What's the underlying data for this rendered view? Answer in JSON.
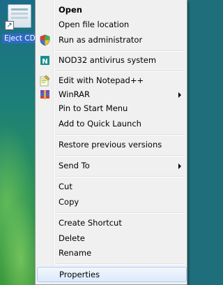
{
  "desktop": {
    "shortcut_label": "Eject CD",
    "shortcut_icon": "shortcut-arrow-icon"
  },
  "menu": {
    "groups": [
      [
        {
          "label": "Open",
          "bold": true
        },
        {
          "label": "Open file location"
        },
        {
          "label": "Run as administrator",
          "icon": "uac-shield-icon"
        }
      ],
      [
        {
          "label": "NOD32 antivirus system",
          "icon": "nod32-icon"
        }
      ],
      [
        {
          "label": "Edit with Notepad++",
          "icon": "notepad-plus-plus-icon"
        },
        {
          "label": "WinRAR",
          "icon": "winrar-icon",
          "submenu": true
        },
        {
          "label": "Pin to Start Menu"
        },
        {
          "label": "Add to Quick Launch"
        }
      ],
      [
        {
          "label": "Restore previous versions"
        }
      ],
      [
        {
          "label": "Send To",
          "submenu": true
        }
      ],
      [
        {
          "label": "Cut"
        },
        {
          "label": "Copy"
        }
      ],
      [
        {
          "label": "Create Shortcut"
        },
        {
          "label": "Delete"
        },
        {
          "label": "Rename"
        }
      ],
      [
        {
          "label": "Properties",
          "hover": true
        }
      ]
    ],
    "colors": {
      "background": "#f0f0f0",
      "hover_border": "#aecff7",
      "hover_fill": "#dbe9f9"
    }
  }
}
